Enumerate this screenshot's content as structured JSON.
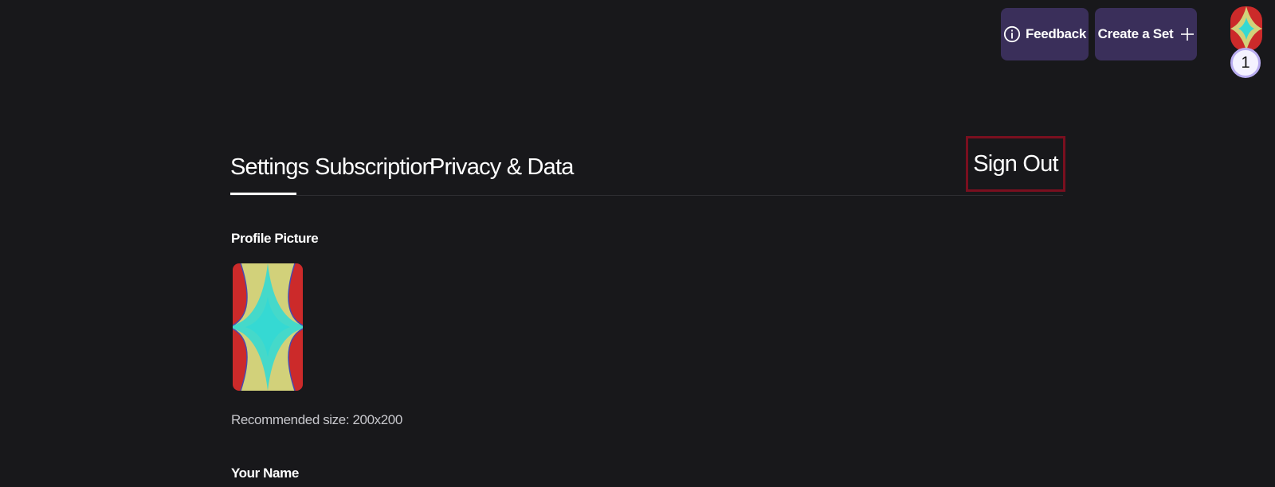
{
  "topbar": {
    "feedback_label": "Feedback",
    "create_label": "Create a Set",
    "notification_count": "1"
  },
  "tabs": [
    {
      "label": "Settings",
      "active": true
    },
    {
      "label": "Subscription",
      "active": false
    },
    {
      "label": "Privacy & Data",
      "active": false
    }
  ],
  "sign_out_label": "Sign Out",
  "settings": {
    "profile_picture_label": "Profile Picture",
    "recommended_size": "Recommended size: 200x200",
    "your_name_label": "Your Name"
  },
  "icons": {
    "feedback": "info-icon",
    "create": "plus-icon"
  },
  "colors": {
    "background": "#18181b",
    "button_bg": "#3a2f5a",
    "signout_border": "#7a0f1f",
    "avatar_red": "#cc2a2a",
    "avatar_yellow": "#d2d17a",
    "avatar_cyan": "#35d9d3"
  }
}
